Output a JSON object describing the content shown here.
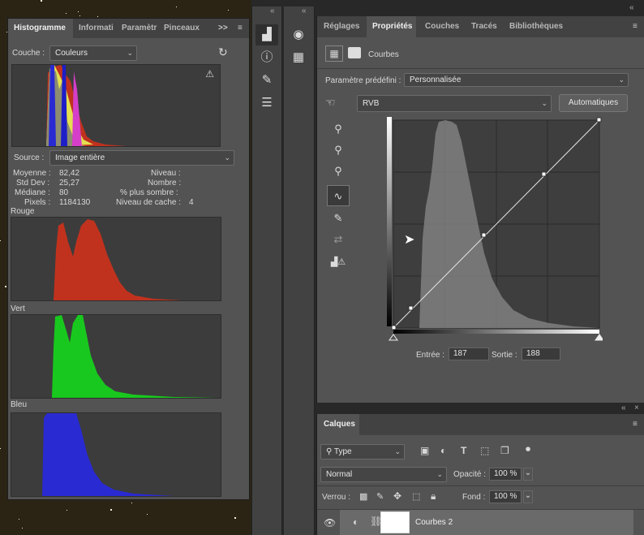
{
  "histogram_panel": {
    "tabs": [
      "Histogramme",
      "Informati",
      "Paramètr",
      "Pinceaux"
    ],
    "more": ">>",
    "channel_label": "Couche :",
    "channel_value": "Couleurs",
    "source_label": "Source :",
    "source_value": "Image entière",
    "stats": {
      "moyenne_label": "Moyenne :",
      "moyenne": "82,42",
      "stddev_label": "Std Dev :",
      "stddev": "25,27",
      "mediane_label": "Médiane :",
      "mediane": "80",
      "pixels_label": "Pixels :",
      "pixels": "1184130",
      "niveau_label": "Niveau :",
      "nombre_label": "Nombre :",
      "sombre_label": "% plus sombre :",
      "cache_label": "Niveau de cache :",
      "cache": "4"
    },
    "channels": [
      "Rouge",
      "Vert",
      "Bleu"
    ],
    "colors": {
      "red": "#c0321e",
      "green": "#19c81e",
      "blue": "#2a2ad2",
      "yellow": "#e4e050"
    }
  },
  "properties_panel": {
    "tabs": [
      "Réglages",
      "Propriétés",
      "Couches",
      "Tracés",
      "Bibliothèques"
    ],
    "title": "Courbes",
    "preset_label": "Paramètre prédéfini :",
    "preset_value": "Personnalisée",
    "channel_value": "RVB",
    "auto_button": "Automatiques",
    "input_label": "Entrée :",
    "input_value": "187",
    "output_label": "Sortie :",
    "output_value": "188"
  },
  "layers_panel": {
    "tab": "Calques",
    "filter_value": "Type",
    "blend_mode": "Normal",
    "opacity_label": "Opacité :",
    "opacity_value": "100 %",
    "lock_label": "Verrou :",
    "fill_label": "Fond :",
    "fill_value": "100 %",
    "layer_name": "Courbes 2"
  },
  "icons": [
    "histogram-icon",
    "info-icon",
    "palette-icon",
    "grid-icon",
    "brush-settings-icon",
    "adjustments-icon",
    "eyedropper-icon",
    "pencil-icon",
    "smooth-icon",
    "clipping-warning-icon",
    "eye-icon",
    "link-icon",
    "lock-icon",
    "refresh-icon",
    "warning-icon"
  ]
}
